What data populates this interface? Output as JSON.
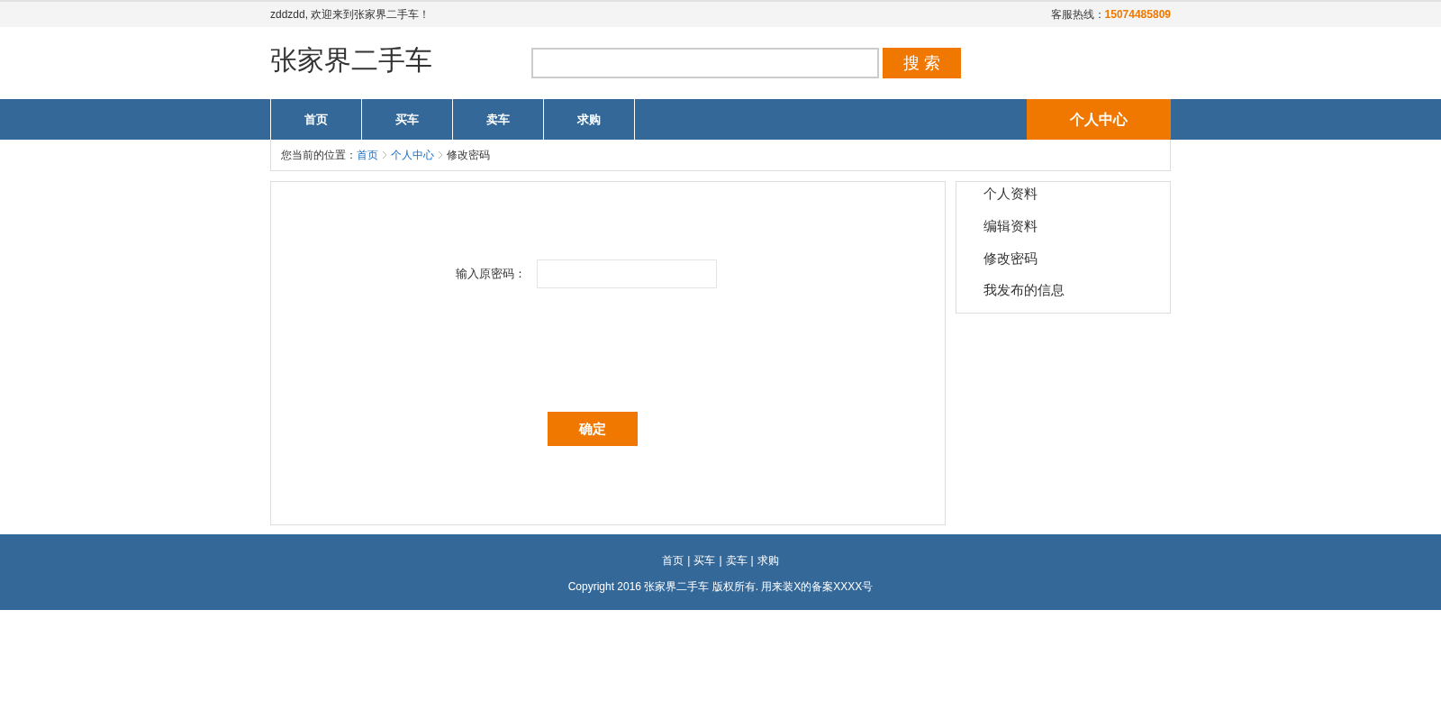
{
  "top_bar": {
    "welcome": "zddzdd, 欢迎来到张家界二手车！",
    "hotline_label": "客服热线：",
    "hotline": "15074485809"
  },
  "header": {
    "logo": "张家界二手车",
    "search_button": "搜 索"
  },
  "nav": {
    "items": [
      {
        "label": "首页"
      },
      {
        "label": "买车"
      },
      {
        "label": "卖车"
      },
      {
        "label": "求购"
      }
    ],
    "user_center": "个人中心"
  },
  "breadcrumb": {
    "prefix": "您当前的位置：",
    "links": [
      "首页",
      "个人中心"
    ],
    "current": "修改密码"
  },
  "form": {
    "label": "输入原密码：",
    "submit": "确定"
  },
  "sidebar": {
    "items": [
      "个人资料",
      "编辑资料",
      "修改密码",
      "我发布的信息"
    ]
  },
  "footer": {
    "links": [
      "首页",
      "买车",
      "卖车",
      "求购"
    ],
    "separator": "|",
    "copyright": "Copyright 2016 张家界二手车 版权所有. 用来装X的备案XXXX号"
  }
}
